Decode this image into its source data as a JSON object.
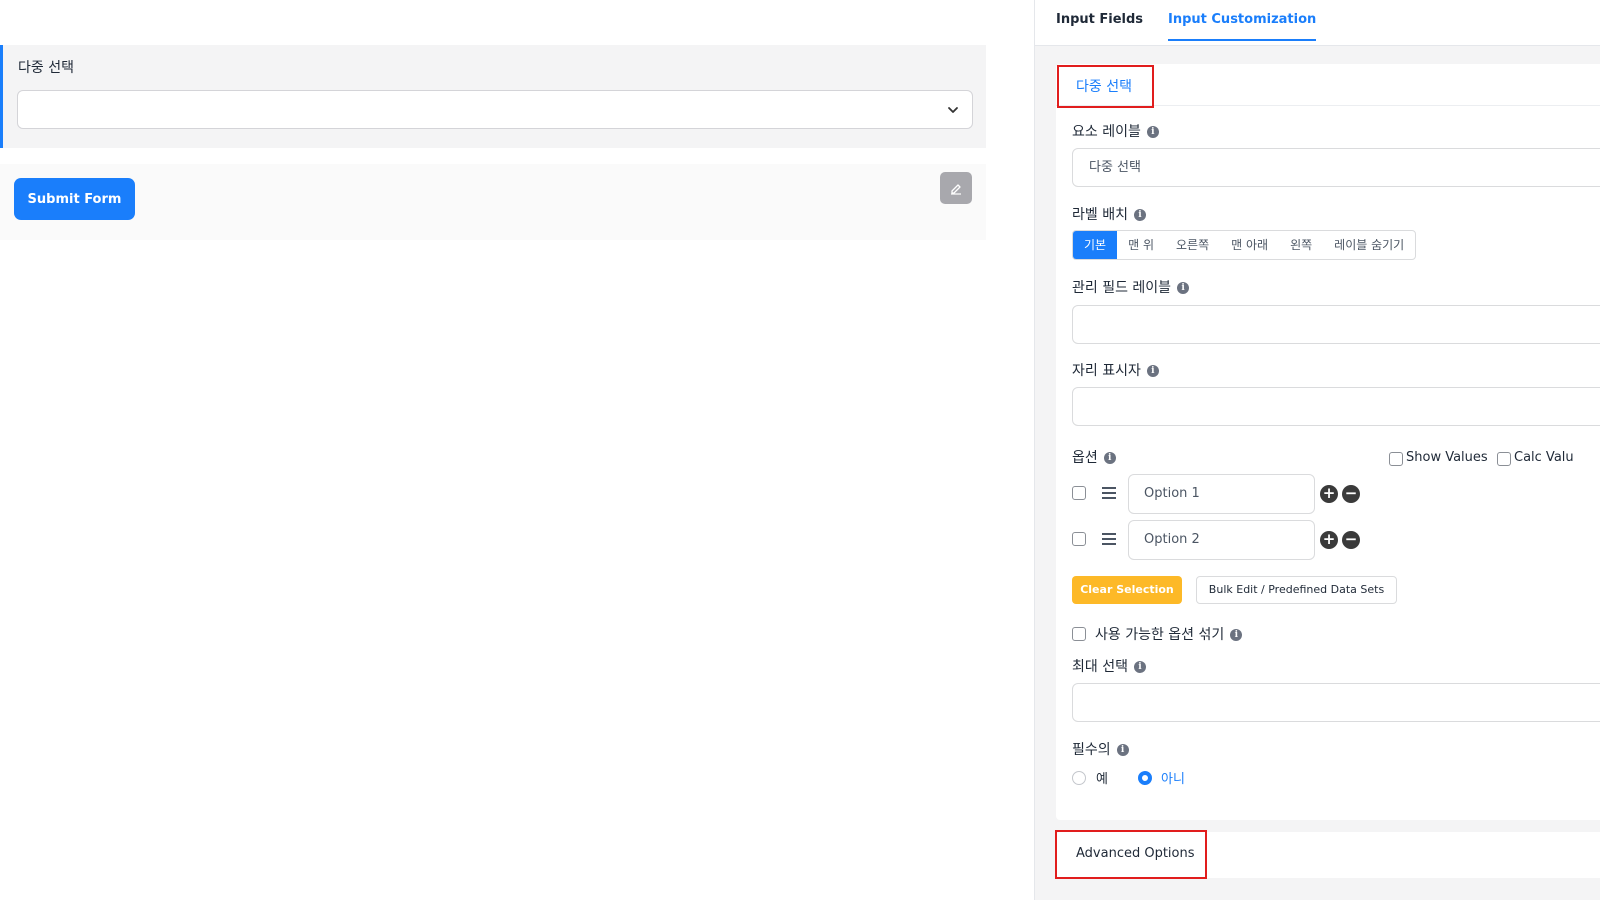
{
  "canvas": {
    "field_label": "다중 선택",
    "submit_label": "Submit Form"
  },
  "tabs": {
    "input_fields": "Input Fields",
    "input_customization": "Input Customization"
  },
  "card": {
    "title": "다중 선택",
    "element_label": {
      "label": "요소 레이블",
      "value": "다중 선택"
    },
    "label_placement": {
      "label": "라벨 배치",
      "options": [
        "기본",
        "맨 위",
        "오른쪽",
        "맨 아래",
        "왼쪽",
        "레이블 숨기기"
      ],
      "selected": "기본"
    },
    "admin_field_label": {
      "label": "관리 필드 레이블",
      "value": ""
    },
    "placeholder": {
      "label": "자리 표시자",
      "value": ""
    },
    "options": {
      "label": "옵션",
      "show_values": "Show Values",
      "calc_values": "Calc Valu",
      "items": [
        "Option 1",
        "Option 2"
      ],
      "clear_selection": "Clear Selection",
      "bulk_edit": "Bulk Edit / Predefined Data Sets"
    },
    "shuffle": "사용 가능한 옵션 섞기",
    "max_selection": {
      "label": "최대 선택",
      "value": ""
    },
    "required": {
      "label": "필수의",
      "yes": "예",
      "no": "아니",
      "selected": "아니"
    }
  },
  "advanced": {
    "title": "Advanced Options"
  },
  "colors": {
    "accent": "#1a7efb",
    "warning": "#fdb927",
    "highlight": "#e11d1d"
  }
}
